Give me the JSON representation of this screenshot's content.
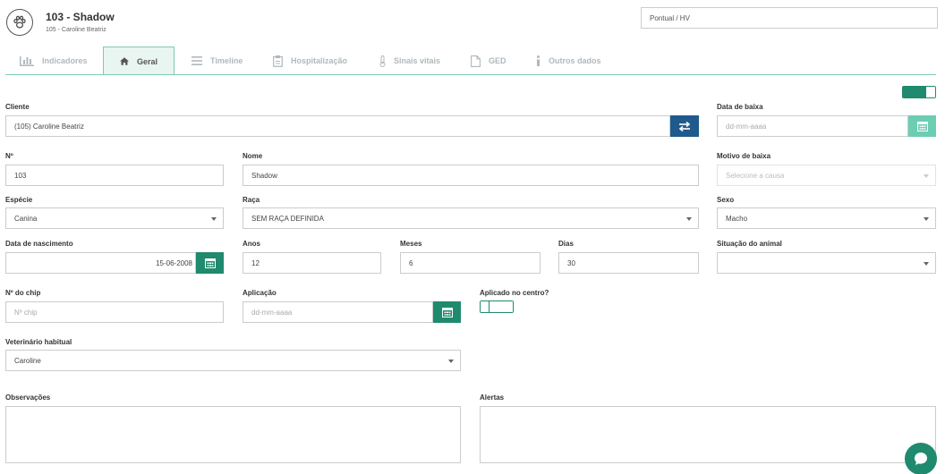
{
  "header": {
    "title": "103 - Shadow",
    "subtitle": "105 - Caroline Beatriz",
    "context_select": "Pontual / HV"
  },
  "tabs": [
    {
      "label": "Indicadores",
      "icon": "bar-chart-icon"
    },
    {
      "label": "Geral",
      "icon": "home-icon",
      "active": true
    },
    {
      "label": "Timeline",
      "icon": "list-icon"
    },
    {
      "label": "Hospitalização",
      "icon": "clipboard-icon"
    },
    {
      "label": "Sinais vitais",
      "icon": "thermometer-icon"
    },
    {
      "label": "GED",
      "icon": "document-icon"
    },
    {
      "label": "Outros dados",
      "icon": "info-icon"
    }
  ],
  "form": {
    "cliente": {
      "label": "Cliente",
      "value": "(105) Caroline Beatriz"
    },
    "data_baixa": {
      "label": "Data de baixa",
      "placeholder": "dd-mm-aaaa"
    },
    "numero": {
      "label": "Nº",
      "value": "103"
    },
    "nome": {
      "label": "Nome",
      "value": "Shadow"
    },
    "motivo_baixa": {
      "label": "Motivo de baixa",
      "placeholder": "Selecione a causa"
    },
    "especie": {
      "label": "Espécie",
      "value": "Canina"
    },
    "raca": {
      "label": "Raça",
      "value": "SEM RAÇA DEFINIDA"
    },
    "sexo": {
      "label": "Sexo",
      "value": "Macho"
    },
    "nascimento": {
      "label": "Data de nascimento",
      "value": "15-06-2008"
    },
    "anos": {
      "label": "Anos",
      "value": "12"
    },
    "meses": {
      "label": "Meses",
      "value": "6"
    },
    "dias": {
      "label": "Dias",
      "value": "30"
    },
    "situacao": {
      "label": "Situação do animal",
      "value": ""
    },
    "chip": {
      "label": "Nº do chip",
      "placeholder": "Nº chip"
    },
    "aplicacao": {
      "label": "Aplicação",
      "placeholder": "dd-mm-aaaa"
    },
    "aplicado_centro": {
      "label": "Aplicado no centro?"
    },
    "veterinario": {
      "label": "Veterinário habitual",
      "value": "Caroline"
    },
    "observacoes": {
      "label": "Observações"
    },
    "alertas": {
      "label": "Alertas"
    }
  },
  "colors": {
    "teal": "#1f8a6e",
    "blue": "#1e5b8c",
    "light_teal": "#6ccdb3",
    "tab_active_bg": "#e8f5f1"
  }
}
